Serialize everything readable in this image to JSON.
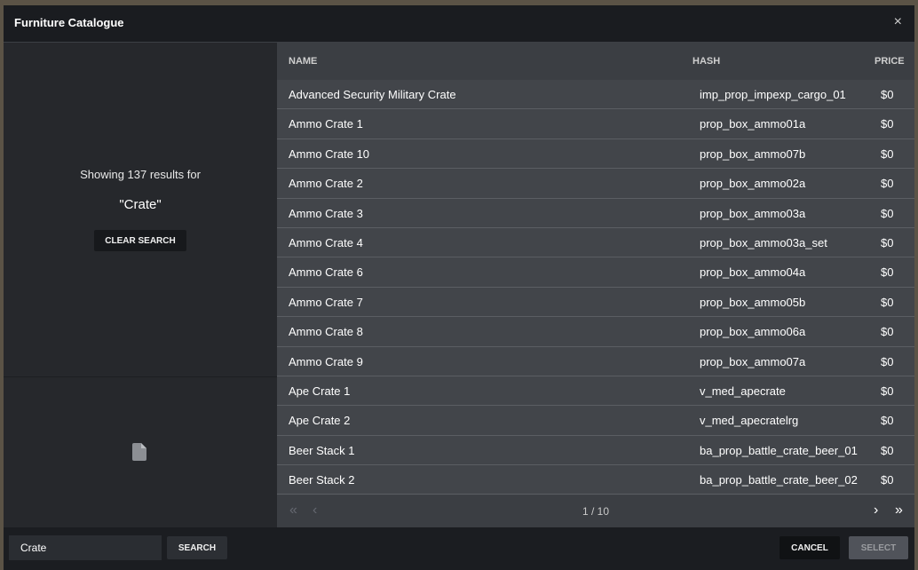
{
  "window": {
    "title": "Furniture Catalogue",
    "close_glyph": "×"
  },
  "search_summary": {
    "results_text": "Showing 137 results for",
    "query_display": "\"Crate\"",
    "clear_label": "CLEAR SEARCH"
  },
  "preview": {
    "icon": "file-icon"
  },
  "table": {
    "headers": {
      "name": "NAME",
      "hash": "HASH",
      "price": "PRICE"
    },
    "rows": [
      {
        "name": "Advanced Security Military Crate",
        "hash": "imp_prop_impexp_cargo_01",
        "price": "$0"
      },
      {
        "name": "Ammo Crate 1",
        "hash": "prop_box_ammo01a",
        "price": "$0"
      },
      {
        "name": "Ammo Crate 10",
        "hash": "prop_box_ammo07b",
        "price": "$0"
      },
      {
        "name": "Ammo Crate 2",
        "hash": "prop_box_ammo02a",
        "price": "$0"
      },
      {
        "name": "Ammo Crate 3",
        "hash": "prop_box_ammo03a",
        "price": "$0"
      },
      {
        "name": "Ammo Crate 4",
        "hash": "prop_box_ammo03a_set",
        "price": "$0"
      },
      {
        "name": "Ammo Crate 6",
        "hash": "prop_box_ammo04a",
        "price": "$0"
      },
      {
        "name": "Ammo Crate 7",
        "hash": "prop_box_ammo05b",
        "price": "$0"
      },
      {
        "name": "Ammo Crate 8",
        "hash": "prop_box_ammo06a",
        "price": "$0"
      },
      {
        "name": "Ammo Crate 9",
        "hash": "prop_box_ammo07a",
        "price": "$0"
      },
      {
        "name": "Ape Crate 1",
        "hash": "v_med_apecrate",
        "price": "$0"
      },
      {
        "name": "Ape Crate 2",
        "hash": "v_med_apecratelrg",
        "price": "$0"
      },
      {
        "name": "Beer Stack 1",
        "hash": "ba_prop_battle_crate_beer_01",
        "price": "$0"
      },
      {
        "name": "Beer Stack 2",
        "hash": "ba_prop_battle_crate_beer_02",
        "price": "$0"
      }
    ]
  },
  "pagination": {
    "first_glyph": "«",
    "prev_glyph": "‹",
    "next_glyph": "›",
    "last_glyph": "»",
    "page_info": "1 / 10"
  },
  "footer": {
    "search_value": "Crate",
    "search_label": "SEARCH",
    "cancel_label": "CANCEL",
    "select_label": "SELECT"
  },
  "colors": {
    "window_bg": "#1e2024",
    "left_panel_bg": "#26282c",
    "table_row_bg": "#42454a",
    "select_disabled_bg": "#50535a"
  }
}
